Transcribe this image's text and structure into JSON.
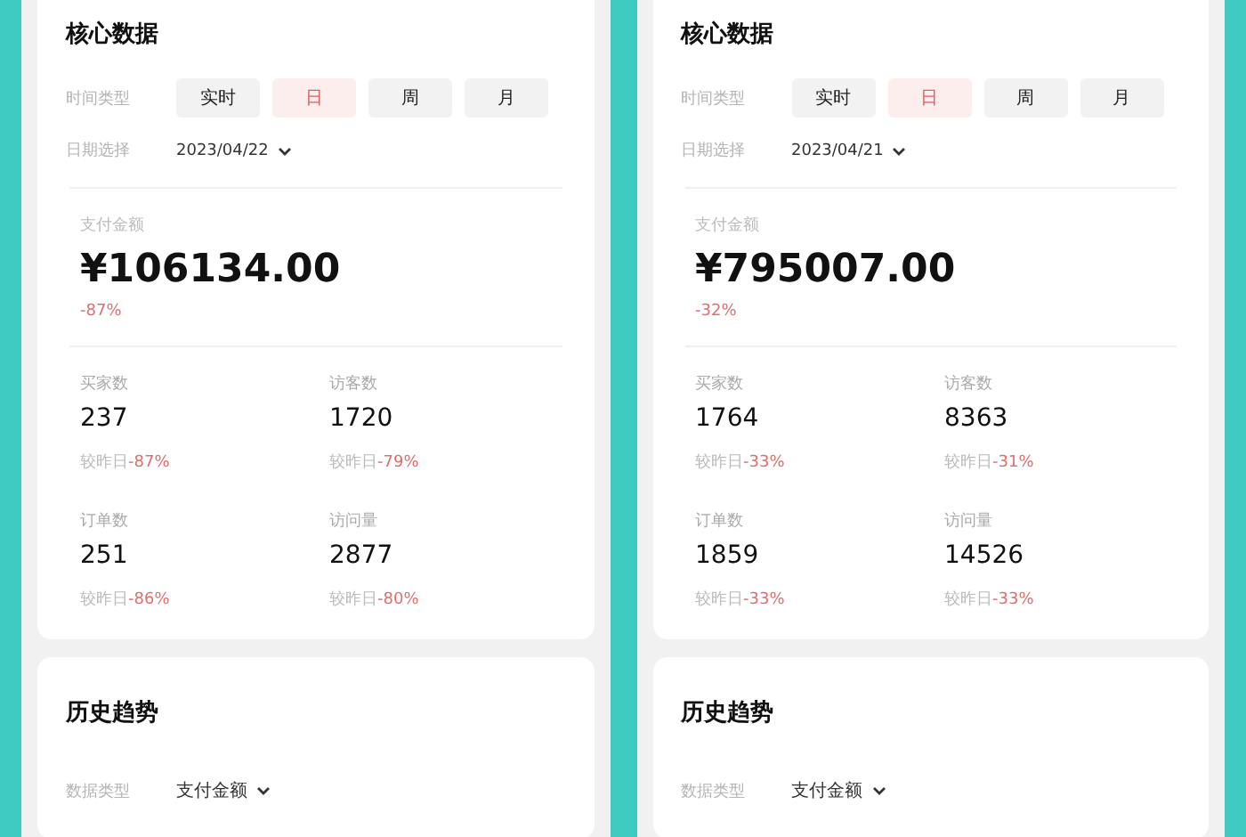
{
  "panels": [
    {
      "core": {
        "title": "核心数据",
        "time_label": "时间类型",
        "tabs": [
          {
            "label": "实时",
            "selected": false
          },
          {
            "label": "日",
            "selected": true
          },
          {
            "label": "周",
            "selected": false
          },
          {
            "label": "月",
            "selected": false
          }
        ],
        "date_label": "日期选择",
        "date": "2023/04/22",
        "amount_label": "支付金额",
        "amount": "¥106134.00",
        "amount_change": "-87%",
        "metrics": [
          {
            "label": "买家数",
            "value": "237",
            "compare": "较昨日",
            "change": "-87%"
          },
          {
            "label": "访客数",
            "value": "1720",
            "compare": "较昨日",
            "change": "-79%"
          },
          {
            "label": "订单数",
            "value": "251",
            "compare": "较昨日",
            "change": "-86%"
          },
          {
            "label": "访问量",
            "value": "2877",
            "compare": "较昨日",
            "change": "-80%"
          }
        ]
      },
      "history": {
        "title": "历史趋势",
        "type_label": "数据类型",
        "type_value": "支付金额"
      }
    },
    {
      "core": {
        "title": "核心数据",
        "time_label": "时间类型",
        "tabs": [
          {
            "label": "实时",
            "selected": false
          },
          {
            "label": "日",
            "selected": true
          },
          {
            "label": "周",
            "selected": false
          },
          {
            "label": "月",
            "selected": false
          }
        ],
        "date_label": "日期选择",
        "date": "2023/04/21",
        "amount_label": "支付金额",
        "amount": "¥795007.00",
        "amount_change": "-32%",
        "metrics": [
          {
            "label": "买家数",
            "value": "1764",
            "compare": "较昨日",
            "change": "-33%"
          },
          {
            "label": "访客数",
            "value": "8363",
            "compare": "较昨日",
            "change": "-31%"
          },
          {
            "label": "订单数",
            "value": "1859",
            "compare": "较昨日",
            "change": "-33%"
          },
          {
            "label": "访问量",
            "value": "14526",
            "compare": "较昨日",
            "change": "-33%"
          }
        ]
      },
      "history": {
        "title": "历史趋势",
        "type_label": "数据类型",
        "type_value": "支付金额"
      }
    }
  ]
}
